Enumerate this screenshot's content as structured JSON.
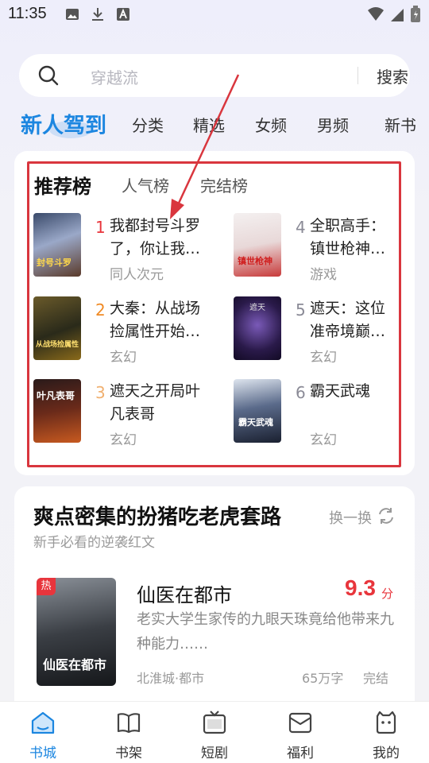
{
  "status_bar": {
    "time": "11:35"
  },
  "search": {
    "placeholder": "穿越流",
    "button": "搜索"
  },
  "top_tabs": [
    "新人驾到",
    "分类",
    "精选",
    "女频",
    "男频",
    "新书"
  ],
  "ranking": {
    "tabs": [
      "推荐榜",
      "人气榜",
      "完结榜"
    ],
    "books": [
      {
        "rank": "1",
        "title_line1": "我都封号斗罗",
        "title_line2": "了，你让我…",
        "tag": "同人次元",
        "cover_text": "封号斗罗",
        "rank_color": "#e8353c"
      },
      {
        "rank": "2",
        "title_line1": "大秦：从战场",
        "title_line2": "捡属性开始…",
        "tag": "玄幻",
        "cover_text": "从战场捡属性",
        "rank_color": "#f08a24"
      },
      {
        "rank": "3",
        "title_line1": "遮天之开局叶",
        "title_line2": "凡表哥",
        "tag": "玄幻",
        "cover_text": "叶凡表哥",
        "rank_color": "#f0b070"
      },
      {
        "rank": "4",
        "title_line1": "全职高手：",
        "title_line2": "镇世枪神…",
        "tag": "游戏",
        "cover_text": "镇世枪神",
        "rank_color": "#8a8a96"
      },
      {
        "rank": "5",
        "title_line1": "遮天：这位",
        "title_line2": "准帝境巅…",
        "tag": "玄幻",
        "cover_text": "遮天",
        "rank_color": "#8a8a96"
      },
      {
        "rank": "6",
        "title_line1": "霸天武魂",
        "title_line2": "",
        "tag": "玄幻",
        "cover_text": "霸天武魂",
        "rank_color": "#8a8a96"
      }
    ]
  },
  "recommend": {
    "title": "爽点密集的扮猪吃老虎套路",
    "subtitle": "新手必看的逆袭红文",
    "refresh": "换一换",
    "featured": {
      "badge": "热",
      "title": "仙医在都市",
      "score": "9.3",
      "score_unit": "分",
      "desc": "老实大学生家传的九眼天珠竟给他带来九种能力……",
      "author_genre": "北淮城·都市",
      "words": "65万字",
      "status": "完结",
      "cover_text": "仙医在都市"
    }
  },
  "bottom_nav": [
    "书城",
    "书架",
    "短剧",
    "福利",
    "我的"
  ],
  "colors": {
    "accent": "#1c86e0",
    "highlight": "#d9363e",
    "score": "#e8353c"
  }
}
